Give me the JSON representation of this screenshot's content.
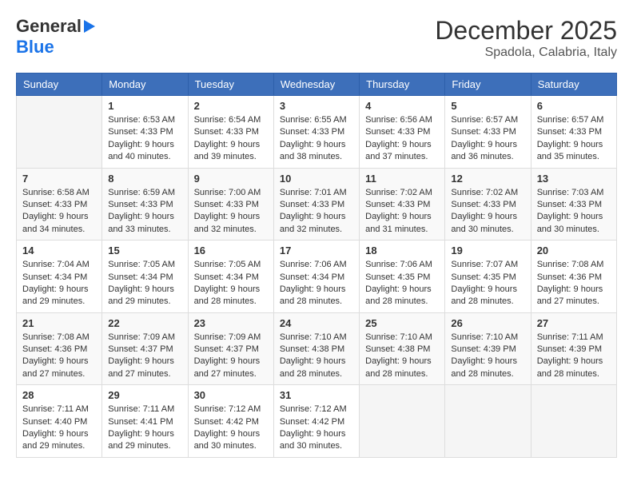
{
  "header": {
    "logo_general": "General",
    "logo_blue": "Blue",
    "month_title": "December 2025",
    "location": "Spadola, Calabria, Italy"
  },
  "calendar": {
    "headers": [
      "Sunday",
      "Monday",
      "Tuesday",
      "Wednesday",
      "Thursday",
      "Friday",
      "Saturday"
    ],
    "weeks": [
      [
        {
          "day": "",
          "info": ""
        },
        {
          "day": "1",
          "info": "Sunrise: 6:53 AM\nSunset: 4:33 PM\nDaylight: 9 hours\nand 40 minutes."
        },
        {
          "day": "2",
          "info": "Sunrise: 6:54 AM\nSunset: 4:33 PM\nDaylight: 9 hours\nand 39 minutes."
        },
        {
          "day": "3",
          "info": "Sunrise: 6:55 AM\nSunset: 4:33 PM\nDaylight: 9 hours\nand 38 minutes."
        },
        {
          "day": "4",
          "info": "Sunrise: 6:56 AM\nSunset: 4:33 PM\nDaylight: 9 hours\nand 37 minutes."
        },
        {
          "day": "5",
          "info": "Sunrise: 6:57 AM\nSunset: 4:33 PM\nDaylight: 9 hours\nand 36 minutes."
        },
        {
          "day": "6",
          "info": "Sunrise: 6:57 AM\nSunset: 4:33 PM\nDaylight: 9 hours\nand 35 minutes."
        }
      ],
      [
        {
          "day": "7",
          "info": "Sunrise: 6:58 AM\nSunset: 4:33 PM\nDaylight: 9 hours\nand 34 minutes."
        },
        {
          "day": "8",
          "info": "Sunrise: 6:59 AM\nSunset: 4:33 PM\nDaylight: 9 hours\nand 33 minutes."
        },
        {
          "day": "9",
          "info": "Sunrise: 7:00 AM\nSunset: 4:33 PM\nDaylight: 9 hours\nand 32 minutes."
        },
        {
          "day": "10",
          "info": "Sunrise: 7:01 AM\nSunset: 4:33 PM\nDaylight: 9 hours\nand 32 minutes."
        },
        {
          "day": "11",
          "info": "Sunrise: 7:02 AM\nSunset: 4:33 PM\nDaylight: 9 hours\nand 31 minutes."
        },
        {
          "day": "12",
          "info": "Sunrise: 7:02 AM\nSunset: 4:33 PM\nDaylight: 9 hours\nand 30 minutes."
        },
        {
          "day": "13",
          "info": "Sunrise: 7:03 AM\nSunset: 4:33 PM\nDaylight: 9 hours\nand 30 minutes."
        }
      ],
      [
        {
          "day": "14",
          "info": "Sunrise: 7:04 AM\nSunset: 4:34 PM\nDaylight: 9 hours\nand 29 minutes."
        },
        {
          "day": "15",
          "info": "Sunrise: 7:05 AM\nSunset: 4:34 PM\nDaylight: 9 hours\nand 29 minutes."
        },
        {
          "day": "16",
          "info": "Sunrise: 7:05 AM\nSunset: 4:34 PM\nDaylight: 9 hours\nand 28 minutes."
        },
        {
          "day": "17",
          "info": "Sunrise: 7:06 AM\nSunset: 4:34 PM\nDaylight: 9 hours\nand 28 minutes."
        },
        {
          "day": "18",
          "info": "Sunrise: 7:06 AM\nSunset: 4:35 PM\nDaylight: 9 hours\nand 28 minutes."
        },
        {
          "day": "19",
          "info": "Sunrise: 7:07 AM\nSunset: 4:35 PM\nDaylight: 9 hours\nand 28 minutes."
        },
        {
          "day": "20",
          "info": "Sunrise: 7:08 AM\nSunset: 4:36 PM\nDaylight: 9 hours\nand 27 minutes."
        }
      ],
      [
        {
          "day": "21",
          "info": "Sunrise: 7:08 AM\nSunset: 4:36 PM\nDaylight: 9 hours\nand 27 minutes."
        },
        {
          "day": "22",
          "info": "Sunrise: 7:09 AM\nSunset: 4:37 PM\nDaylight: 9 hours\nand 27 minutes."
        },
        {
          "day": "23",
          "info": "Sunrise: 7:09 AM\nSunset: 4:37 PM\nDaylight: 9 hours\nand 27 minutes."
        },
        {
          "day": "24",
          "info": "Sunrise: 7:10 AM\nSunset: 4:38 PM\nDaylight: 9 hours\nand 28 minutes."
        },
        {
          "day": "25",
          "info": "Sunrise: 7:10 AM\nSunset: 4:38 PM\nDaylight: 9 hours\nand 28 minutes."
        },
        {
          "day": "26",
          "info": "Sunrise: 7:10 AM\nSunset: 4:39 PM\nDaylight: 9 hours\nand 28 minutes."
        },
        {
          "day": "27",
          "info": "Sunrise: 7:11 AM\nSunset: 4:39 PM\nDaylight: 9 hours\nand 28 minutes."
        }
      ],
      [
        {
          "day": "28",
          "info": "Sunrise: 7:11 AM\nSunset: 4:40 PM\nDaylight: 9 hours\nand 29 minutes."
        },
        {
          "day": "29",
          "info": "Sunrise: 7:11 AM\nSunset: 4:41 PM\nDaylight: 9 hours\nand 29 minutes."
        },
        {
          "day": "30",
          "info": "Sunrise: 7:12 AM\nSunset: 4:42 PM\nDaylight: 9 hours\nand 30 minutes."
        },
        {
          "day": "31",
          "info": "Sunrise: 7:12 AM\nSunset: 4:42 PM\nDaylight: 9 hours\nand 30 minutes."
        },
        {
          "day": "",
          "info": ""
        },
        {
          "day": "",
          "info": ""
        },
        {
          "day": "",
          "info": ""
        }
      ]
    ]
  }
}
